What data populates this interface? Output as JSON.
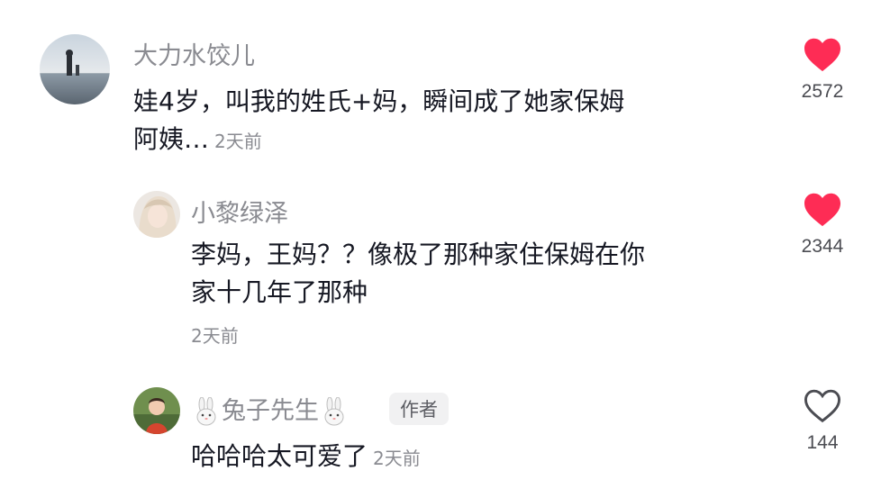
{
  "comments": [
    {
      "username": "大力水饺儿",
      "text": "娃4岁，叫我的姓氏+妈，瞬间成了她家保姆",
      "text_line2": "阿姨…",
      "time": "2天前",
      "likes": "2572",
      "liked": true
    },
    {
      "username": "小黎绿泽",
      "text": "李妈，王妈？？像极了那种家住保姆在你",
      "text_line2": "家十几年了那种",
      "time": "2天前",
      "likes": "2344",
      "liked": true
    },
    {
      "username": "兔子先生",
      "author_tag": "作者",
      "text": "哈哈哈太可爱了",
      "time": "2天前",
      "likes": "144",
      "liked": false
    }
  ],
  "colors": {
    "like_red": "#fe2c55",
    "muted_text": "#8a8b91",
    "main_text": "#161823"
  },
  "icons": [
    "heart-filled-icon",
    "heart-outline-icon",
    "rabbit-icon"
  ]
}
